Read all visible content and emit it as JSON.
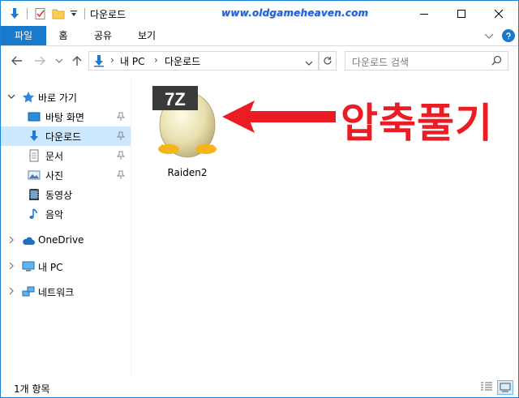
{
  "window": {
    "title": "다운로드",
    "watermark": "www.oldgameheaven.com"
  },
  "ribbon": {
    "tabs": [
      {
        "label": "파일"
      },
      {
        "label": "홈"
      },
      {
        "label": "공유"
      },
      {
        "label": "보기"
      }
    ]
  },
  "address": {
    "crumbs": [
      "내 PC",
      "다운로드"
    ]
  },
  "search": {
    "placeholder": "다운로드 검색"
  },
  "sidebar": {
    "quick_access": "바로 가기",
    "items": [
      {
        "label": "바탕 화면",
        "icon": "desktop-icon",
        "pinned": true
      },
      {
        "label": "다운로드",
        "icon": "download-icon",
        "pinned": true,
        "selected": true
      },
      {
        "label": "문서",
        "icon": "document-icon",
        "pinned": true
      },
      {
        "label": "사진",
        "icon": "picture-icon",
        "pinned": true
      },
      {
        "label": "동영상",
        "icon": "video-icon"
      },
      {
        "label": "음악",
        "icon": "music-icon"
      }
    ],
    "onedrive": "OneDrive",
    "this_pc": "내 PC",
    "network": "네트워크"
  },
  "content": {
    "files": [
      {
        "name": "Raiden2",
        "badge": "7Z"
      }
    ]
  },
  "annotation": {
    "text": "압축풀기",
    "color": "#ec1c24"
  },
  "status": {
    "item_count": "1개 항목"
  },
  "colors": {
    "accent": "#1979ca",
    "selection": "#cce8ff"
  }
}
